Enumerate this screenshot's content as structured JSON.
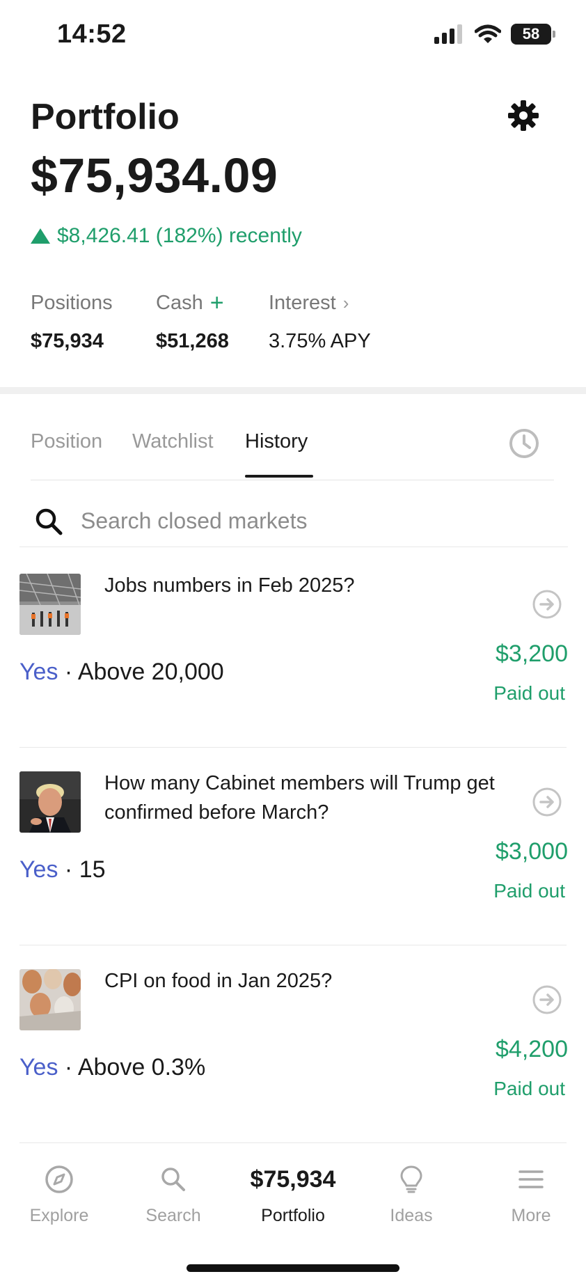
{
  "status_bar": {
    "time": "14:52",
    "battery": "58"
  },
  "header": {
    "title": "Portfolio",
    "balance": "$75,934.09",
    "change": "$8,426.41 (182%) recently"
  },
  "stats": {
    "positions": {
      "label": "Positions",
      "value": "$75,934"
    },
    "cash": {
      "label": "Cash",
      "value": "$51,268",
      "action": "+"
    },
    "interest": {
      "label": "Interest",
      "value": "3.75% APY"
    }
  },
  "tabs": {
    "items": [
      {
        "label": "Position"
      },
      {
        "label": "Watchlist"
      },
      {
        "label": "History"
      }
    ],
    "active": "History"
  },
  "search": {
    "placeholder": "Search closed markets",
    "value": ""
  },
  "markets": [
    {
      "title": "Jobs numbers in Feb 2025?",
      "side": "Yes",
      "outcome": "Above 20,000",
      "amount": "$3,200",
      "status": "Paid out"
    },
    {
      "title": "How many Cabinet members will Trump get confirmed before March?",
      "side": "Yes",
      "outcome": "15",
      "amount": "$3,000",
      "status": "Paid out"
    },
    {
      "title": "CPI on food in Jan 2025?",
      "side": "Yes",
      "outcome": "Above 0.3%",
      "amount": "$4,200",
      "status": "Paid out"
    }
  ],
  "bottom_nav": {
    "explore": "Explore",
    "search": "Search",
    "portfolio_amount": "$75,934",
    "portfolio": "Portfolio",
    "ideas": "Ideas",
    "more": "More"
  },
  "colors": {
    "positive": "#1f9e6b",
    "yes": "#4a5fc9",
    "text": "#1a1a1a",
    "muted": "#999999"
  },
  "icons": [
    "signal-icon",
    "wifi-icon",
    "battery-icon",
    "gear-icon",
    "clock-icon",
    "search-icon",
    "arrow-right-circle-icon",
    "compass-icon",
    "lightbulb-icon",
    "menu-icon"
  ]
}
